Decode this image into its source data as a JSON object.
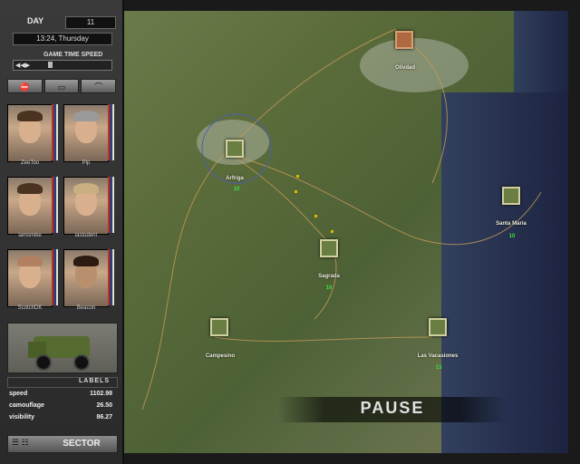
{
  "clock": {
    "day_label": "DAY",
    "day": "11",
    "time": "13:24, Thursday",
    "speed_label": "GAME TIME SPEED",
    "speed_value": 0.2
  },
  "toolbar": {
    "icons": [
      "stop-icon",
      "sleep-icon",
      "sleep-alt-icon"
    ]
  },
  "mercs": [
    {
      "name": "ZeeToo",
      "bar_colors": [
        "#c03030",
        "#3050c0",
        "#e0e0e0"
      ]
    },
    {
      "name": "Pip",
      "bar_colors": [
        "#c03030",
        "#3050c0",
        "#e0e0e0"
      ]
    },
    {
      "name": "iamsmike",
      "bar_colors": [
        "#c03030",
        "#3050c0",
        "#e0e0e0"
      ]
    },
    {
      "name": "iastudent",
      "bar_colors": [
        "#c03030",
        "#3050c0",
        "#e0e0e0"
      ]
    },
    {
      "name": "ScotchDK",
      "bar_colors": [
        "#c03030",
        "#3050c0",
        "#e0e0e0"
      ]
    },
    {
      "name": "Beacon",
      "bar_colors": [
        "#c03030",
        "#3050c0",
        "#e0e0e0"
      ]
    }
  ],
  "vehicle_panel": {
    "labels_title": "LABELS",
    "stats": [
      {
        "name": "speed",
        "value": "1102.98"
      },
      {
        "name": "camouflage",
        "value": "26.50"
      },
      {
        "name": "visibility",
        "value": "86.27"
      }
    ]
  },
  "bottom": {
    "sector": "SECTOR"
  },
  "map": {
    "pause": "PAUSE",
    "towns": [
      {
        "name": "Olivdad",
        "value": "",
        "type": "enemy"
      },
      {
        "name": "Arfriga",
        "value": "10",
        "type": "friendly"
      },
      {
        "name": "Santa Maria",
        "value": "10",
        "type": "friendly"
      },
      {
        "name": "Sagrada",
        "value": "10",
        "type": "friendly"
      },
      {
        "name": "Campesino",
        "value": "",
        "type": "friendly"
      },
      {
        "name": "Las Vacasiones",
        "value": "13",
        "type": "friendly"
      }
    ]
  }
}
